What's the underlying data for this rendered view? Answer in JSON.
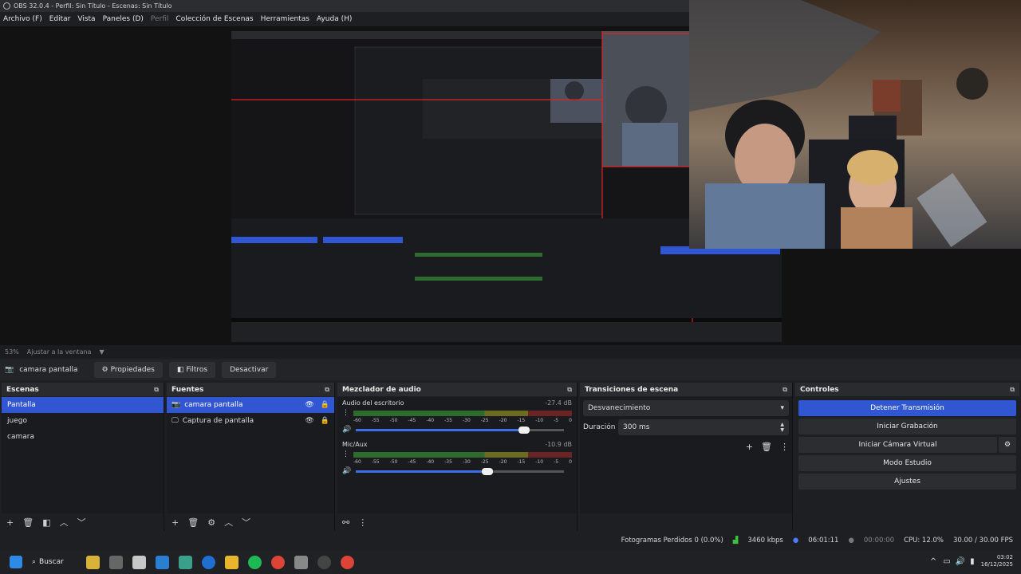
{
  "window": {
    "title": "OBS 32.0.4 - Perfil: Sin Título - Escenas: Sin Título"
  },
  "menu": {
    "items": [
      "Archivo (F)",
      "Editar",
      "Vista",
      "Paneles (D)",
      "Perfil",
      "Colección de Escenas",
      "Herramientas",
      "Ayuda (H)"
    ]
  },
  "preview": {
    "zoom": "53%",
    "fit_label": "Ajustar a la ventana",
    "measure_h": "1296 px",
    "measure_v": "611 px"
  },
  "source_toolbar": {
    "source_name": "camara pantalla",
    "properties": "Propiedades",
    "filters": "Filtros",
    "deactivate": "Desactivar"
  },
  "scenes": {
    "title": "Escenas",
    "items": [
      "Pantalla",
      "juego",
      "camara"
    ],
    "selected": 0
  },
  "sources": {
    "title": "Fuentes",
    "items": [
      {
        "name": "camara pantalla",
        "icon": "camera-icon"
      },
      {
        "name": "Captura de pantalla",
        "icon": "monitor-icon"
      }
    ],
    "selected": 0
  },
  "mixer": {
    "title": "Mezclador de audio",
    "channels": [
      {
        "name": "Audio del escritorio",
        "db": "-27.4 dB",
        "volume": 0.81
      },
      {
        "name": "Mic/Aux",
        "db": "-10.9 dB",
        "volume": 0.63
      }
    ],
    "ticks": [
      "-60",
      "-55",
      "-50",
      "-45",
      "-40",
      "-35",
      "-30",
      "-25",
      "-20",
      "-15",
      "-10",
      "-5",
      "0"
    ]
  },
  "transitions": {
    "title": "Transiciones de escena",
    "type": "Desvanecimiento",
    "duration_label": "Duración",
    "duration": "300 ms"
  },
  "controls": {
    "title": "Controles",
    "stop_stream": "Detener Transmisión",
    "start_record": "Iniciar Grabación",
    "start_vcam": "Iniciar Cámara Virtual",
    "studio": "Modo Estudio",
    "settings": "Ajustes"
  },
  "status": {
    "dropped": "Fotogramas Perdidos 0 (0.0%)",
    "bitrate": "3460 kbps",
    "stream_time": "06:01:11",
    "rec_time": "00:00:00",
    "cpu": "CPU: 12.0%",
    "fps": "30.00 / 30.00 FPS"
  },
  "taskbar": {
    "search": "Buscar",
    "time": "03:02",
    "date": "16/12/2025"
  },
  "colors": {
    "accent": "#3057d1",
    "bg": "#1e1f22"
  }
}
